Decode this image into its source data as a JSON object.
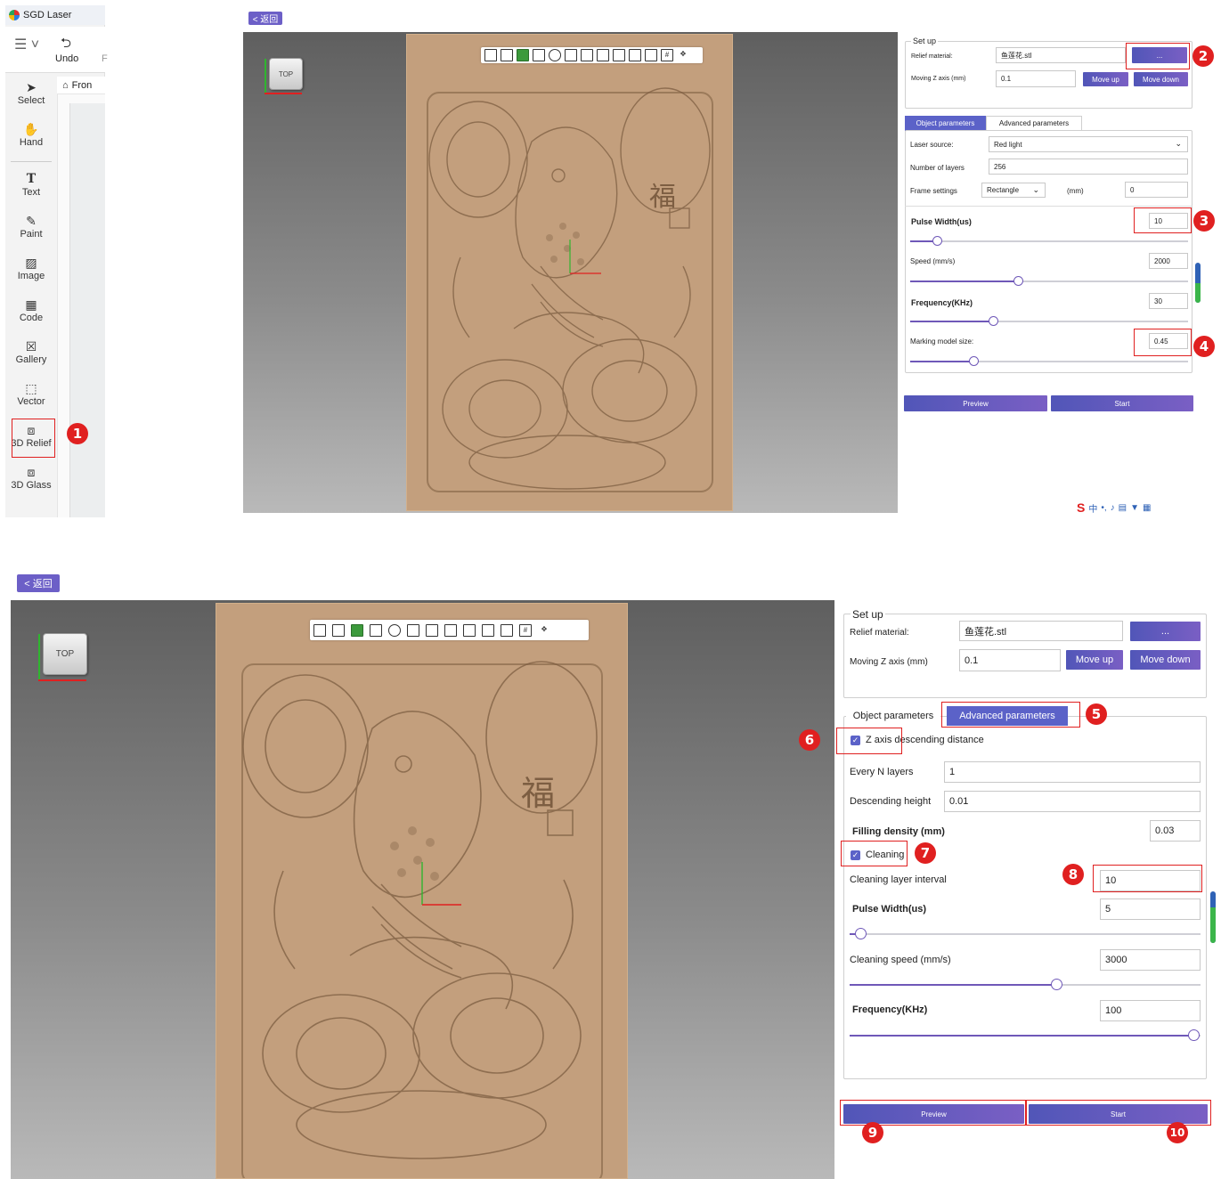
{
  "app": {
    "title": "SGD Laser",
    "undo_label": "Undo",
    "truncated_menu": "F",
    "home_tab_label": "Fron"
  },
  "tools": [
    {
      "label": "Select",
      "icon": "select-icon"
    },
    {
      "label": "Hand",
      "icon": "hand-icon"
    },
    {
      "label": "Text",
      "icon": "text-icon"
    },
    {
      "label": "Paint",
      "icon": "paint-icon"
    },
    {
      "label": "Image",
      "icon": "image-icon"
    },
    {
      "label": "Code",
      "icon": "qr-code-icon"
    },
    {
      "label": "Gallery",
      "icon": "gallery-icon"
    },
    {
      "label": "Vector",
      "icon": "vector-icon"
    },
    {
      "label": "3D Relief",
      "icon": "3d-relief-icon"
    },
    {
      "label": "3D Glass",
      "icon": "3d-glass-icon"
    }
  ],
  "back_label": "< 返回",
  "viewcube_label": "TOP",
  "relief_glyph": "福",
  "setup": {
    "legend": "Set up",
    "relief_material_label": "Relief material:",
    "relief_material_value": "鱼莲花.stl",
    "browse_label": "...",
    "moving_z_label": "Moving Z axis (mm)",
    "moving_z_value": "0.1",
    "move_up": "Move up",
    "move_down": "Move down"
  },
  "tabs": {
    "object": "Object parameters",
    "advanced": "Advanced parameters"
  },
  "object_params": {
    "laser_source_label": "Laser source:",
    "laser_source_value": "Red light",
    "layers_label": "Number of layers",
    "layers_value": "256",
    "frame_label": "Frame settings",
    "frame_value": "Rectangle",
    "frame_unit": "(mm)",
    "frame_offset": "0",
    "pulse_label": "Pulse Width(us)",
    "pulse_value": "10",
    "pulse_level": 0.1,
    "speed_label": "Speed (mm/s)",
    "speed_value": "2000",
    "speed_level": 0.39,
    "freq_label": "Frequency(KHz)",
    "freq_value": "30",
    "freq_level": 0.3,
    "size_label": "Marking model size:",
    "size_value": "0.45",
    "size_level": 0.23
  },
  "advanced_params": {
    "z_descend_label": "Z axis descending distance",
    "every_n_label": "Every N layers",
    "every_n_value": "1",
    "desc_height_label": "Descending height",
    "desc_height_value": "0.01",
    "fill_density_label": "Filling density (mm)",
    "fill_density_value": "0.03",
    "cleaning_label": "Cleaning",
    "clean_interval_label": "Cleaning layer interval",
    "clean_interval_value": "10",
    "pulse_label": "Pulse Width(us)",
    "pulse_value": "5",
    "pulse_level": 0.03,
    "clean_speed_label": "Cleaning speed (mm/s)",
    "clean_speed_value": "3000",
    "clean_speed_level": 0.59,
    "freq_label": "Frequency(KHz)",
    "freq_value": "100",
    "freq_level": 0.98
  },
  "actions": {
    "preview": "Preview",
    "start": "Start"
  },
  "ime_label": "中",
  "steps": [
    "1",
    "2",
    "3",
    "4",
    "5",
    "6",
    "7",
    "8",
    "9",
    "10"
  ],
  "colors": {
    "accent": "#5b62c8",
    "annotation": "#e02020",
    "relief": "#c39f7d"
  }
}
